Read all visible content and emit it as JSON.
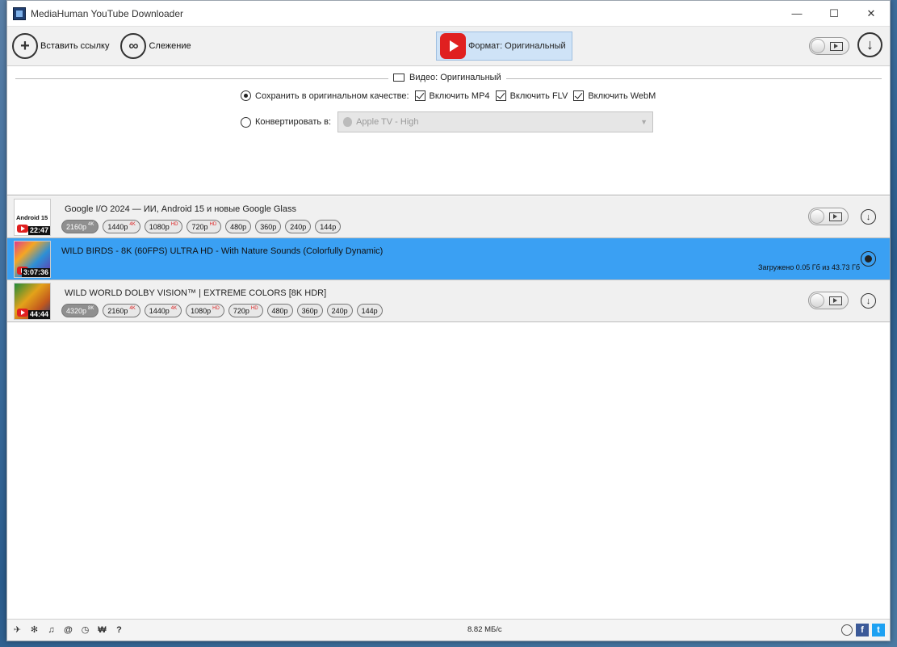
{
  "window": {
    "title": "MediaHuman YouTube Downloader",
    "minimize": "—",
    "maximize": "☐",
    "close": "✕"
  },
  "toolbar": {
    "paste_label": "Вставить ссылку",
    "tracking_label": "Слежение",
    "format_label": "Формат: Оригинальный"
  },
  "settings": {
    "section_title": "Видео: Оригинальный",
    "save_original_label": "Сохранить в оригинальном качестве:",
    "mp4_label": "Включить MP4",
    "flv_label": "Включить FLV",
    "webm_label": "Включить WebM",
    "convert_label": "Конвертировать в:",
    "convert_value": "Apple TV - High",
    "mode": "original",
    "mp4_checked": true,
    "flv_checked": true,
    "webm_checked": true
  },
  "items": [
    {
      "title": "Google I/O 2024 — ИИ, Android 15 и новые Google Glass",
      "duration": "22:47",
      "thumb_label": "Android 15",
      "resolutions": [
        {
          "label": "2160p",
          "tag": "4K",
          "active": true
        },
        {
          "label": "1440p",
          "tag": "4K",
          "active": false
        },
        {
          "label": "1080p",
          "tag": "HD",
          "active": false
        },
        {
          "label": "720p",
          "tag": "HD",
          "active": false
        },
        {
          "label": "480p",
          "tag": "",
          "active": false
        },
        {
          "label": "360p",
          "tag": "",
          "active": false
        },
        {
          "label": "240p",
          "tag": "",
          "active": false
        },
        {
          "label": "144p",
          "tag": "",
          "active": false
        }
      ]
    },
    {
      "title": "WILD BIRDS - 8K (60FPS) ULTRA HD - With Nature Sounds (Colorfully Dynamic)",
      "duration": "3:07:36",
      "progress_text": "Загружено 0.05 Гб из 43.73 Гб",
      "downloading": true
    },
    {
      "title": "WILD WORLD DOLBY VISION™ | EXTREME COLORS [8K HDR]",
      "duration": "44:44",
      "resolutions": [
        {
          "label": "4320p",
          "tag": "8K",
          "active": true
        },
        {
          "label": "2160p",
          "tag": "4K",
          "active": false
        },
        {
          "label": "1440p",
          "tag": "4K",
          "active": false
        },
        {
          "label": "1080p",
          "tag": "HD",
          "active": false
        },
        {
          "label": "720p",
          "tag": "HD",
          "active": false
        },
        {
          "label": "480p",
          "tag": "",
          "active": false
        },
        {
          "label": "360p",
          "tag": "",
          "active": false
        },
        {
          "label": "240p",
          "tag": "",
          "active": false
        },
        {
          "label": "144p",
          "tag": "",
          "active": false
        }
      ]
    }
  ],
  "statusbar": {
    "speed": "8.82 МБ/с",
    "icons": [
      "send-icon",
      "gear-icon",
      "music-icon",
      "snail-icon",
      "clock-icon",
      "binoculars-icon",
      "help-icon"
    ],
    "icon_glyphs": [
      "✈",
      "✻",
      "♫",
      "@",
      "◷",
      "₩",
      "?"
    ],
    "facebook_glyph": "f",
    "twitter_glyph": "t"
  },
  "glyphs": {
    "plus": "+",
    "binoculars": "∞",
    "download_arrow": "↓",
    "combo_caret": "▼"
  },
  "colors": {
    "selected_row": "#3aa0f3",
    "youtube_red": "#e02020",
    "format_button_bg": "#cfe3f7"
  }
}
